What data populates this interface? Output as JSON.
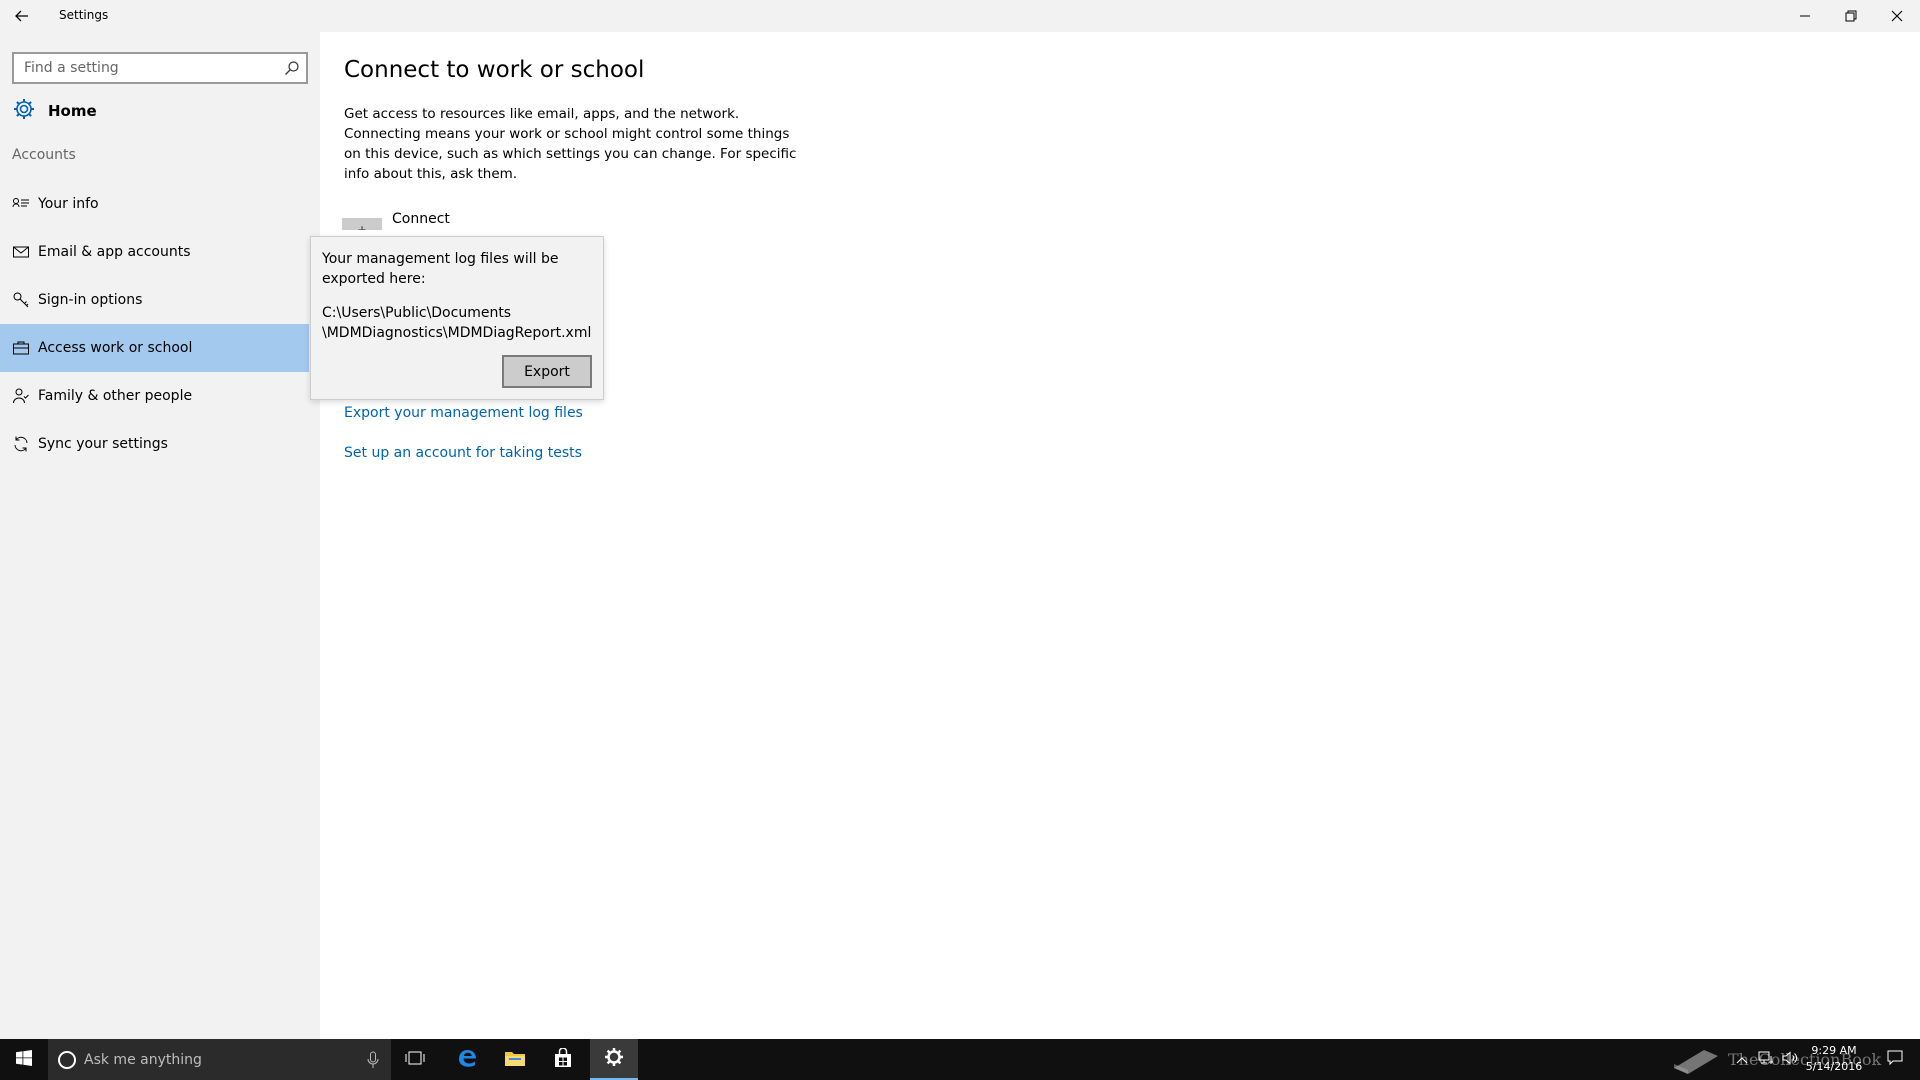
{
  "window": {
    "title": "Settings"
  },
  "sidebar": {
    "search_placeholder": "Find a setting",
    "home_label": "Home",
    "section_label": "Accounts",
    "items": [
      {
        "label": "Your info",
        "icon": "person-card-icon"
      },
      {
        "label": "Email & app accounts",
        "icon": "mail-icon"
      },
      {
        "label": "Sign-in options",
        "icon": "key-icon"
      },
      {
        "label": "Access work or school",
        "icon": "briefcase-icon",
        "selected": true
      },
      {
        "label": "Family & other people",
        "icon": "people-icon"
      },
      {
        "label": "Sync your settings",
        "icon": "sync-icon"
      }
    ]
  },
  "main": {
    "title": "Connect to work or school",
    "description": "Get access to resources like email, apps, and the network. Connecting means your work or school might control some things on this device, such as which settings you can change. For specific info about this, ask them.",
    "connect_label": "Connect",
    "connect_icon": "+",
    "links": [
      "Export your management log files",
      "Set up an account for taking tests"
    ]
  },
  "flyout": {
    "message": "Your management log files will be exported here:",
    "path_line1": "C:\\Users\\Public\\Documents",
    "path_line2": "\\MDMDiagnostics\\MDMDiagReport.xml",
    "button": "Export"
  },
  "taskbar": {
    "search_placeholder": "Ask me anything",
    "time": "9:29 AM",
    "date": "5/14/2016",
    "watermark": "TheCollectionBook"
  },
  "colors": {
    "accent": "#0063b1",
    "selected_nav": "#a3c9ee",
    "sidebar_bg": "#f2f2f2",
    "taskbar_bg": "#101010"
  }
}
